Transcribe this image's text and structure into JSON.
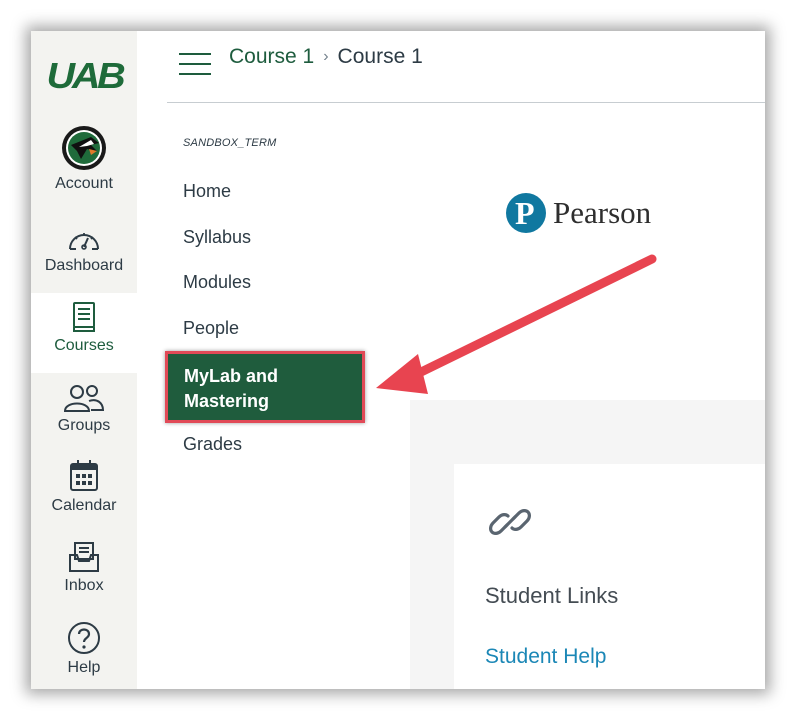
{
  "global_nav": {
    "logo_text": "UAB",
    "items": [
      {
        "label": "Account",
        "icon": "avatar-icon"
      },
      {
        "label": "Dashboard",
        "icon": "dashboard-icon"
      },
      {
        "label": "Courses",
        "icon": "courses-icon"
      },
      {
        "label": "Groups",
        "icon": "groups-icon"
      },
      {
        "label": "Calendar",
        "icon": "calendar-icon"
      },
      {
        "label": "Inbox",
        "icon": "inbox-icon"
      },
      {
        "label": "Help",
        "icon": "help-icon"
      }
    ],
    "active_item": "Courses",
    "accent_color": "#1e5c3e"
  },
  "breadcrumb": {
    "link": "Course 1",
    "separator": "›",
    "current": "Course 1"
  },
  "course_nav": {
    "term": "SANDBOX_TERM",
    "items": [
      "Home",
      "Syllabus",
      "Modules",
      "People",
      "MyLab and Mastering",
      "Grades"
    ],
    "active_item": "MyLab and Mastering",
    "highlight_border_color": "#e14a57"
  },
  "content": {
    "pearson_logo_text": "Pearson",
    "card_title": "Student Links",
    "card_link": "Student Help",
    "link_color": "#1b87b6"
  },
  "annotation": {
    "arrow_color": "#e84450",
    "points_to": "MyLab and Mastering"
  }
}
